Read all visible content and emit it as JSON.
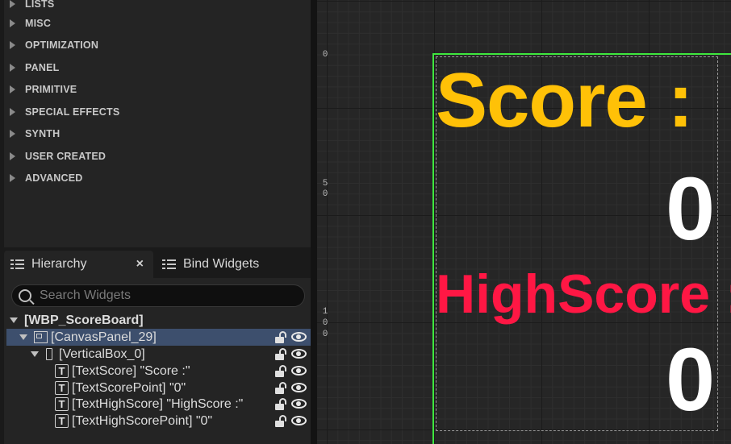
{
  "palette": {
    "categories": [
      "LISTS",
      "MISC",
      "OPTIMIZATION",
      "PANEL",
      "PRIMITIVE",
      "SPECIAL EFFECTS",
      "SYNTH",
      "USER CREATED",
      "ADVANCED"
    ]
  },
  "tabs": {
    "hierarchy": "Hierarchy",
    "close": "×",
    "bind_widgets": "Bind Widgets"
  },
  "search": {
    "placeholder": "Search Widgets"
  },
  "tree": {
    "root": "[WBP_ScoreBoard]",
    "canvas": "[CanvasPanel_29]",
    "vbox": "[VerticalBox_0]",
    "items": [
      "[TextScore] \"Score :\"",
      "[TextScorePoint] \"0\"",
      "[TextHighScore] \"HighScore :\"",
      "[TextHighScorePoint] \"0\""
    ],
    "text_icon": "T"
  },
  "ruler": {
    "t0": "0",
    "t50a": "5",
    "t50b": "0",
    "t100a": "1",
    "t100b": "0",
    "t100c": "0"
  },
  "canvas": {
    "score_label": "Score :",
    "score_value": "0",
    "highscore_label": "HighScore :",
    "highscore_value": "0"
  },
  "colors": {
    "score": "#ffc107",
    "highscore": "#ff1744",
    "selection": "#3d4f6d",
    "frame": "#3ee63e"
  }
}
